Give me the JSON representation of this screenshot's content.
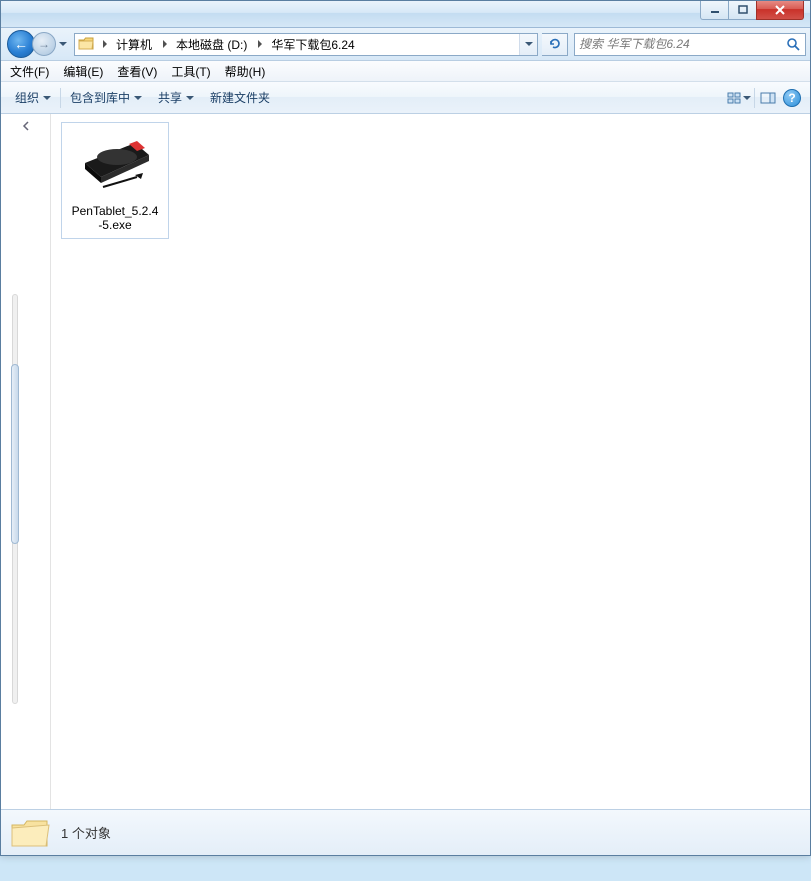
{
  "titlebar": {
    "min_tip": "Minimize",
    "max_tip": "Maximize",
    "close_tip": "Close"
  },
  "breadcrumb": {
    "items": [
      "计算机",
      "本地磁盘 (D:)",
      "华军下载包6.24"
    ]
  },
  "search": {
    "placeholder": "搜索 华军下载包6.24"
  },
  "menubar": {
    "items": [
      "文件(F)",
      "编辑(E)",
      "查看(V)",
      "工具(T)",
      "帮助(H)"
    ]
  },
  "toolbar": {
    "organize": "组织",
    "include": "包含到库中",
    "share": "共享",
    "newfolder": "新建文件夹"
  },
  "files": {
    "items": [
      {
        "name_line1": "PenTablet_5.2.4",
        "name_line2": "-5.exe"
      }
    ]
  },
  "statusbar": {
    "text": "1 个对象"
  }
}
